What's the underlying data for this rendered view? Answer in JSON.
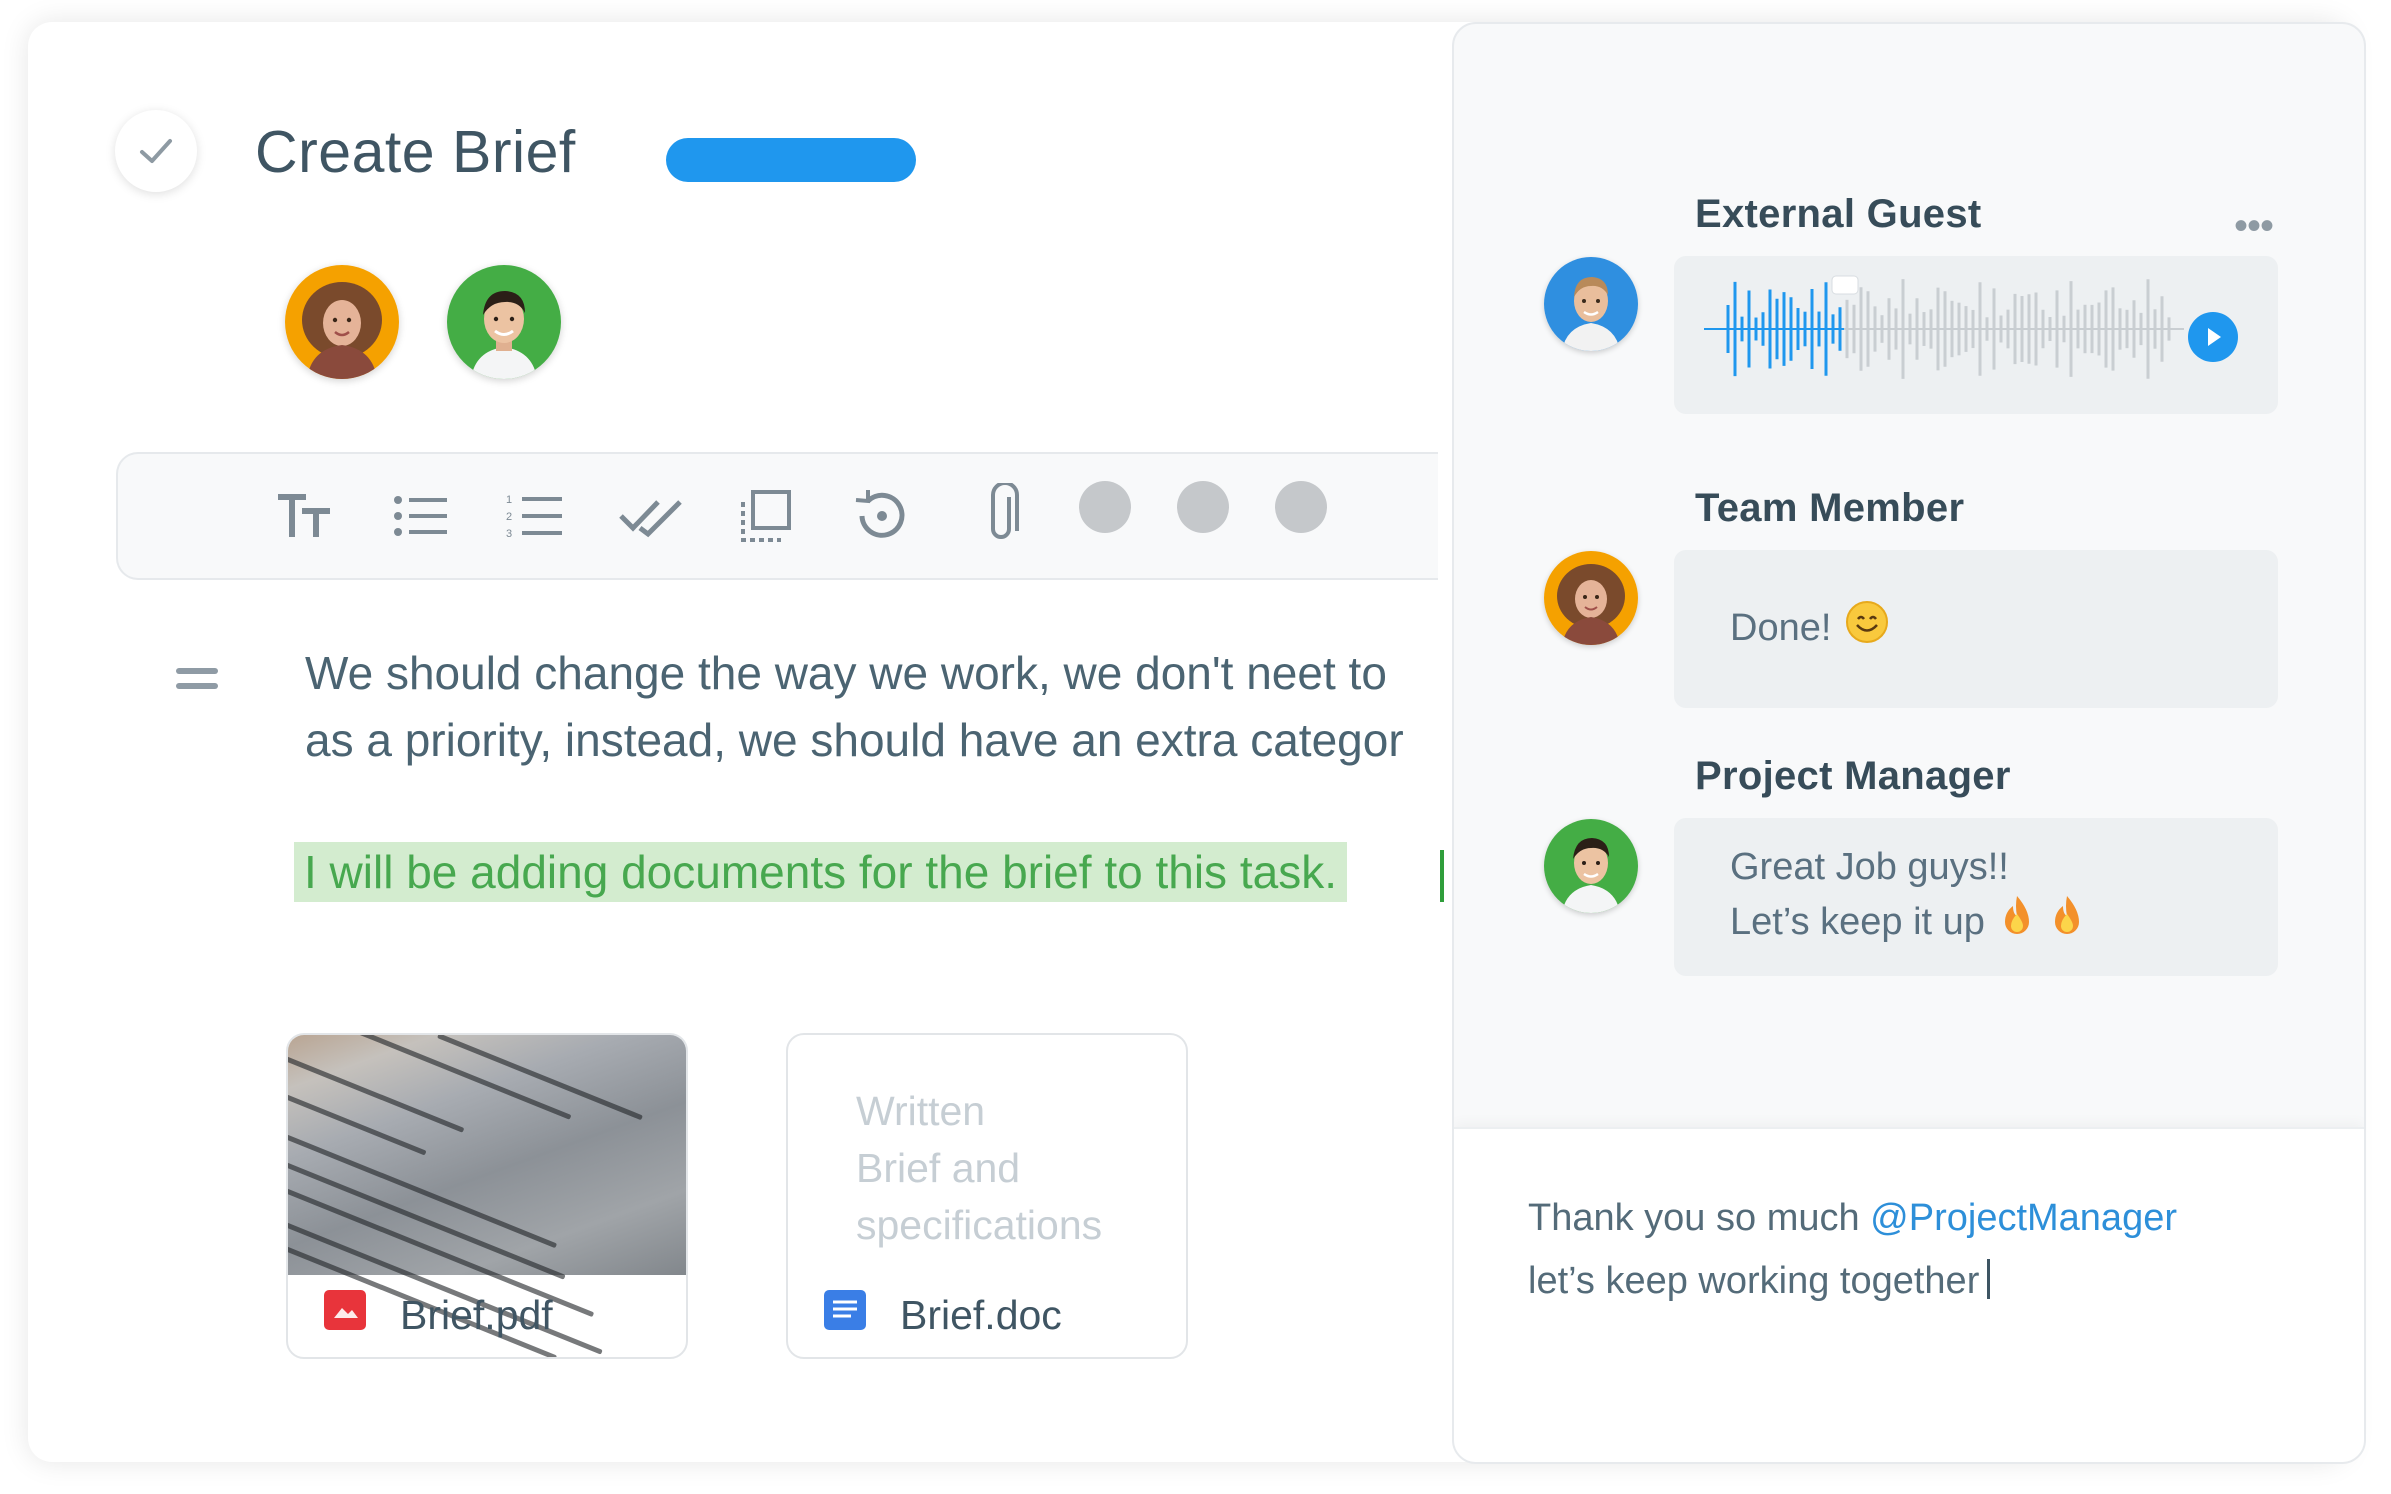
{
  "task": {
    "title": "Create Brief",
    "status_color": "#1f97ee",
    "assignees": [
      "avatar-woman-curly-hair",
      "avatar-man-green"
    ]
  },
  "toolbar": {
    "icons": [
      "text-size-icon",
      "bullet-list-icon",
      "numbered-list-icon",
      "checklist-icon",
      "select-icon",
      "history-icon",
      "attachment-icon"
    ],
    "placeholder_dots": 3
  },
  "body": {
    "paragraph_line1": "We should change the way we work, we don't neet to",
    "paragraph_line2": "as a priority, instead, we should have an extra categor",
    "highlight": "I will be adding documents for the brief to this task."
  },
  "files": [
    {
      "name": "Brief.pdf",
      "icon": "pdf-icon",
      "icon_color": "#e8343b",
      "preview": "document-photo"
    },
    {
      "name": "Brief.doc",
      "icon": "doc-icon",
      "icon_color": "#3a7ee6",
      "preview_text": [
        "Written",
        "Brief and",
        "specifications"
      ]
    }
  ],
  "chat": {
    "messages": [
      {
        "author": "External Guest",
        "type": "voice",
        "avatar": "avatar-man-blue"
      },
      {
        "author": "Team Member",
        "type": "text",
        "avatar": "avatar-woman-curly-hair",
        "lines": [
          "Done!"
        ],
        "emoji": "smile"
      },
      {
        "author": "Project Manager",
        "type": "text",
        "avatar": "avatar-man-green",
        "lines": [
          "Great Job guys!!",
          "Let’s keep it up"
        ],
        "emoji": "fire"
      }
    ],
    "composer": {
      "line1": "Thank you so much",
      "mention": "@ProjectManager",
      "line2": "let’s keep working together"
    },
    "accent": "#1f97ee"
  }
}
